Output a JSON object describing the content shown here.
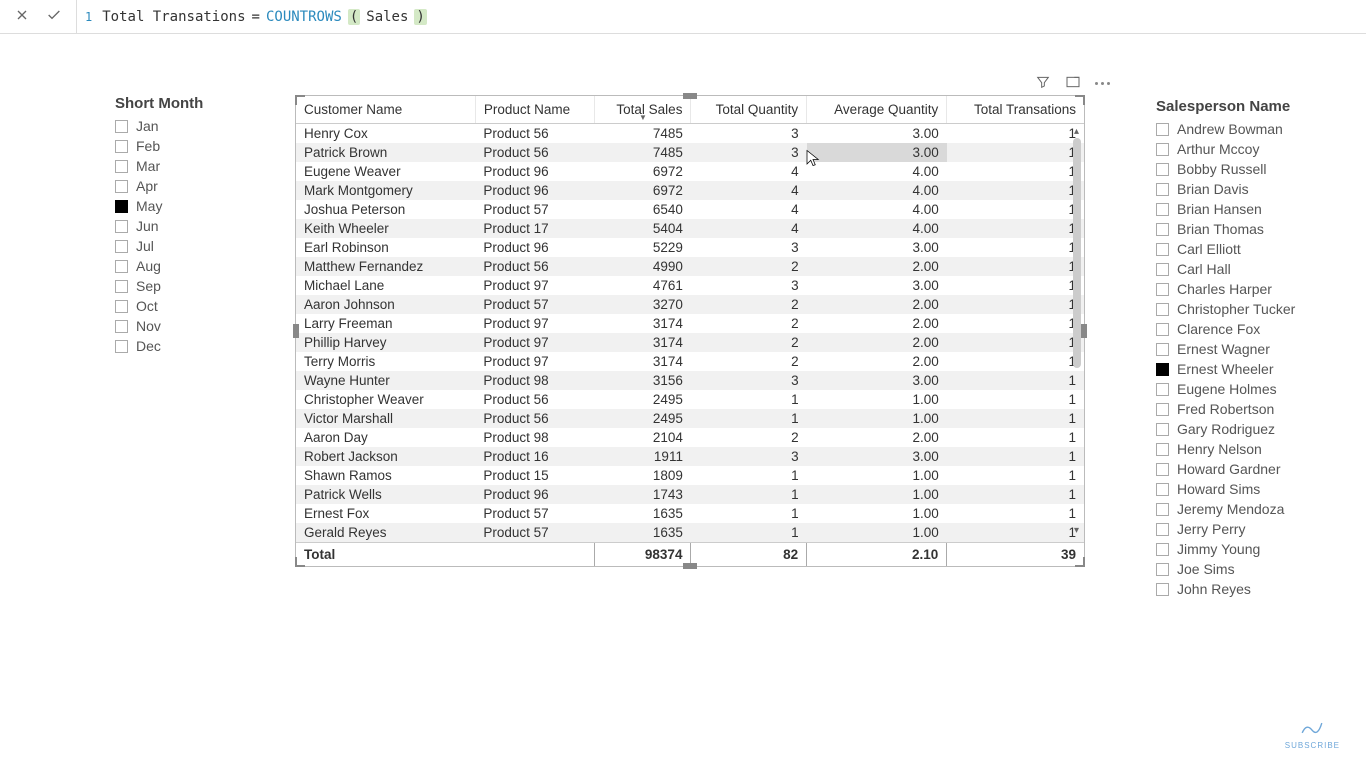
{
  "formula": {
    "line": "1",
    "name": "Total Transations",
    "eq": "=",
    "func": "COUNTROWS",
    "open": "(",
    "arg": "Sales",
    "close": ")"
  },
  "month_slicer": {
    "title": "Short Month",
    "items": [
      {
        "label": "Jan",
        "checked": false
      },
      {
        "label": "Feb",
        "checked": false
      },
      {
        "label": "Mar",
        "checked": false
      },
      {
        "label": "Apr",
        "checked": false
      },
      {
        "label": "May",
        "checked": true
      },
      {
        "label": "Jun",
        "checked": false
      },
      {
        "label": "Jul",
        "checked": false
      },
      {
        "label": "Aug",
        "checked": false
      },
      {
        "label": "Sep",
        "checked": false
      },
      {
        "label": "Oct",
        "checked": false
      },
      {
        "label": "Nov",
        "checked": false
      },
      {
        "label": "Dec",
        "checked": false
      }
    ]
  },
  "sales_slicer": {
    "title": "Salesperson Name",
    "items": [
      {
        "label": "Andrew Bowman",
        "checked": false
      },
      {
        "label": "Arthur Mccoy",
        "checked": false
      },
      {
        "label": "Bobby Russell",
        "checked": false
      },
      {
        "label": "Brian Davis",
        "checked": false
      },
      {
        "label": "Brian Hansen",
        "checked": false
      },
      {
        "label": "Brian Thomas",
        "checked": false
      },
      {
        "label": "Carl Elliott",
        "checked": false
      },
      {
        "label": "Carl Hall",
        "checked": false
      },
      {
        "label": "Charles Harper",
        "checked": false
      },
      {
        "label": "Christopher Tucker",
        "checked": false
      },
      {
        "label": "Clarence Fox",
        "checked": false
      },
      {
        "label": "Ernest Wagner",
        "checked": false
      },
      {
        "label": "Ernest Wheeler",
        "checked": true
      },
      {
        "label": "Eugene Holmes",
        "checked": false
      },
      {
        "label": "Fred Robertson",
        "checked": false
      },
      {
        "label": "Gary Rodriguez",
        "checked": false
      },
      {
        "label": "Henry Nelson",
        "checked": false
      },
      {
        "label": "Howard Gardner",
        "checked": false
      },
      {
        "label": "Howard Sims",
        "checked": false
      },
      {
        "label": "Jeremy Mendoza",
        "checked": false
      },
      {
        "label": "Jerry Perry",
        "checked": false
      },
      {
        "label": "Jimmy Young",
        "checked": false
      },
      {
        "label": "Joe Sims",
        "checked": false
      },
      {
        "label": "John Reyes",
        "checked": false
      }
    ]
  },
  "table": {
    "headers": {
      "customer": "Customer Name",
      "product": "Product Name",
      "sales": "Total Sales",
      "qty": "Total Quantity",
      "avg": "Average Quantity",
      "trans": "Total Transations"
    },
    "rows": [
      {
        "customer": "Henry Cox",
        "product": "Product 56",
        "sales": "7485",
        "qty": "3",
        "avg": "3.00",
        "trans": "1"
      },
      {
        "customer": "Patrick Brown",
        "product": "Product 56",
        "sales": "7485",
        "qty": "3",
        "avg": "3.00",
        "trans": "1",
        "hover": true
      },
      {
        "customer": "Eugene Weaver",
        "product": "Product 96",
        "sales": "6972",
        "qty": "4",
        "avg": "4.00",
        "trans": "1"
      },
      {
        "customer": "Mark Montgomery",
        "product": "Product 96",
        "sales": "6972",
        "qty": "4",
        "avg": "4.00",
        "trans": "1"
      },
      {
        "customer": "Joshua Peterson",
        "product": "Product 57",
        "sales": "6540",
        "qty": "4",
        "avg": "4.00",
        "trans": "1"
      },
      {
        "customer": "Keith Wheeler",
        "product": "Product 17",
        "sales": "5404",
        "qty": "4",
        "avg": "4.00",
        "trans": "1"
      },
      {
        "customer": "Earl Robinson",
        "product": "Product 96",
        "sales": "5229",
        "qty": "3",
        "avg": "3.00",
        "trans": "1"
      },
      {
        "customer": "Matthew Fernandez",
        "product": "Product 56",
        "sales": "4990",
        "qty": "2",
        "avg": "2.00",
        "trans": "1"
      },
      {
        "customer": "Michael Lane",
        "product": "Product 97",
        "sales": "4761",
        "qty": "3",
        "avg": "3.00",
        "trans": "1"
      },
      {
        "customer": "Aaron Johnson",
        "product": "Product 57",
        "sales": "3270",
        "qty": "2",
        "avg": "2.00",
        "trans": "1"
      },
      {
        "customer": "Larry Freeman",
        "product": "Product 97",
        "sales": "3174",
        "qty": "2",
        "avg": "2.00",
        "trans": "1"
      },
      {
        "customer": "Phillip Harvey",
        "product": "Product 97",
        "sales": "3174",
        "qty": "2",
        "avg": "2.00",
        "trans": "1"
      },
      {
        "customer": "Terry Morris",
        "product": "Product 97",
        "sales": "3174",
        "qty": "2",
        "avg": "2.00",
        "trans": "1"
      },
      {
        "customer": "Wayne Hunter",
        "product": "Product 98",
        "sales": "3156",
        "qty": "3",
        "avg": "3.00",
        "trans": "1"
      },
      {
        "customer": "Christopher Weaver",
        "product": "Product 56",
        "sales": "2495",
        "qty": "1",
        "avg": "1.00",
        "trans": "1"
      },
      {
        "customer": "Victor Marshall",
        "product": "Product 56",
        "sales": "2495",
        "qty": "1",
        "avg": "1.00",
        "trans": "1"
      },
      {
        "customer": "Aaron Day",
        "product": "Product 98",
        "sales": "2104",
        "qty": "2",
        "avg": "2.00",
        "trans": "1"
      },
      {
        "customer": "Robert Jackson",
        "product": "Product 16",
        "sales": "1911",
        "qty": "3",
        "avg": "3.00",
        "trans": "1"
      },
      {
        "customer": "Shawn Ramos",
        "product": "Product 15",
        "sales": "1809",
        "qty": "1",
        "avg": "1.00",
        "trans": "1"
      },
      {
        "customer": "Patrick Wells",
        "product": "Product 96",
        "sales": "1743",
        "qty": "1",
        "avg": "1.00",
        "trans": "1"
      },
      {
        "customer": "Ernest Fox",
        "product": "Product 57",
        "sales": "1635",
        "qty": "1",
        "avg": "1.00",
        "trans": "1"
      },
      {
        "customer": "Gerald Reyes",
        "product": "Product 57",
        "sales": "1635",
        "qty": "1",
        "avg": "1.00",
        "trans": "1"
      }
    ],
    "totals": {
      "label": "Total",
      "sales": "98374",
      "qty": "82",
      "avg": "2.10",
      "trans": "39"
    }
  },
  "watermark": {
    "text": "SUBSCRIBE"
  }
}
